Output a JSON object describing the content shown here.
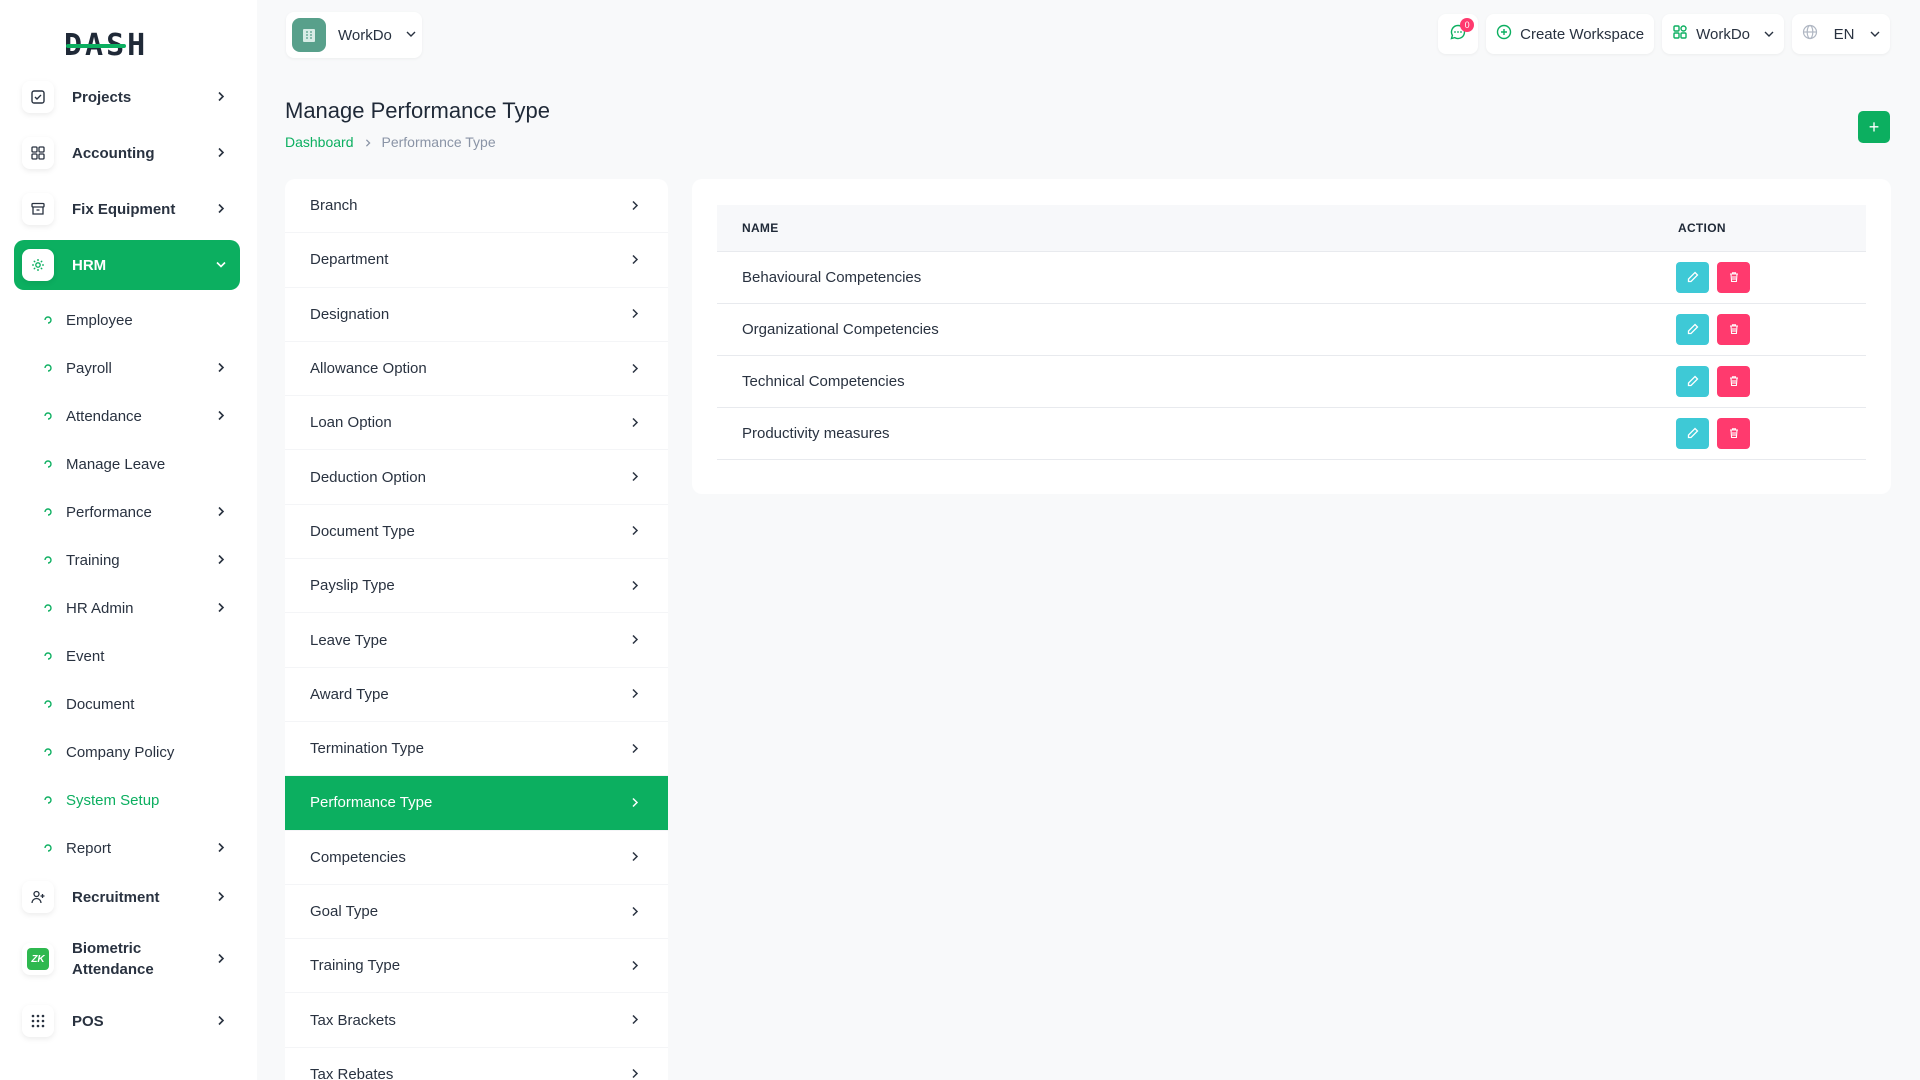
{
  "brand": {
    "logo_text": "DASH"
  },
  "colors": {
    "primary": "#0caf60",
    "info": "#3ec9d6",
    "danger": "#ff3a6e"
  },
  "sidebar": {
    "items": [
      {
        "label": "Projects",
        "icon": "checkbox-icon"
      },
      {
        "label": "Accounting",
        "icon": "grid-icon"
      },
      {
        "label": "Fix Equipment",
        "icon": "archive-icon"
      },
      {
        "label": "HRM",
        "icon": "hrm-icon"
      }
    ],
    "hrm_sub": [
      {
        "label": "Employee"
      },
      {
        "label": "Payroll"
      },
      {
        "label": "Attendance"
      },
      {
        "label": "Manage Leave"
      },
      {
        "label": "Performance"
      },
      {
        "label": "Training"
      },
      {
        "label": "HR Admin"
      },
      {
        "label": "Event"
      },
      {
        "label": "Document"
      },
      {
        "label": "Company Policy"
      },
      {
        "label": "System Setup"
      },
      {
        "label": "Report"
      }
    ],
    "bottom": [
      {
        "label": "Recruitment",
        "icon": "user-plus-icon"
      },
      {
        "label": "Biometric Attendance",
        "icon": "zk-icon",
        "badge": "ZK"
      },
      {
        "label": "POS",
        "icon": "dots-grid-icon"
      }
    ]
  },
  "header": {
    "workspace": "WorkDo",
    "notifications": "0",
    "create_workspace": "Create Workspace",
    "workspace_menu": "WorkDo",
    "language": "EN"
  },
  "page": {
    "title": "Manage Performance Type",
    "breadcrumb": {
      "home": "Dashboard",
      "current": "Performance Type"
    },
    "add_button": "+"
  },
  "setup_menu": [
    "Branch",
    "Department",
    "Designation",
    "Allowance Option",
    "Loan Option",
    "Deduction Option",
    "Document Type",
    "Payslip Type",
    "Leave Type",
    "Award Type",
    "Termination Type",
    "Performance Type",
    "Competencies",
    "Goal Type",
    "Training Type",
    "Tax Brackets",
    "Tax Rebates"
  ],
  "table": {
    "headers": {
      "name": "NAME",
      "action": "ACTION"
    },
    "rows": [
      {
        "name": "Behavioural Competencies"
      },
      {
        "name": "Organizational Competencies"
      },
      {
        "name": "Technical Competencies"
      },
      {
        "name": "Productivity measures"
      }
    ]
  }
}
